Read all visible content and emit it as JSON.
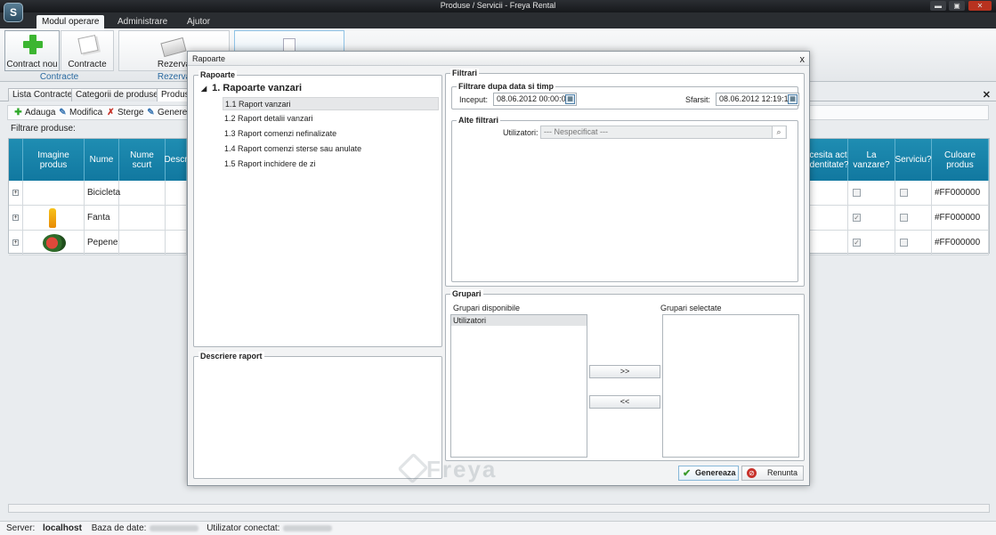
{
  "window": {
    "title": "Produse / Servicii - Freya Rental",
    "logo": "S",
    "minimize": "▬",
    "maximize": "▣",
    "close": "✕"
  },
  "ribbon": {
    "tabs": [
      "Modul operare",
      "Administrare",
      "Ajutor"
    ],
    "buttons": {
      "contract_nou": "Contract nou",
      "contracte": "Contracte",
      "rezerva": "Rezerva"
    },
    "groups": {
      "contracte": "Contracte",
      "rezerva": "Rezerva"
    }
  },
  "main_tabs": [
    "Lista Contracte",
    "Categorii de produse",
    "Produse"
  ],
  "toolbar": {
    "adauga": "Adauga",
    "modifica": "Modifica",
    "sterge": "Sterge",
    "genereaza": "Genereaza"
  },
  "filter_label": "Filtrare produse:",
  "grid": {
    "headers": {
      "imagine": "Imagine produs",
      "nume": "Nume",
      "nume_scurt": "Nume scurt",
      "descriere": "Descr",
      "act": "cesita act identitate?",
      "la_vanzare": "La vanzare?",
      "serviciu": "Serviciu?",
      "culoare": "Culoare produs"
    },
    "rows": [
      {
        "nume": "Bicicleta",
        "culoare": "#FF000000",
        "la_vanzare": false,
        "serviciu": false,
        "image": ""
      },
      {
        "nume": "Fanta",
        "culoare": "#FF000000",
        "la_vanzare": true,
        "serviciu": false,
        "image": "bottle-icon"
      },
      {
        "nume": "Pepene",
        "culoare": "#FF000000",
        "la_vanzare": true,
        "serviciu": false,
        "image": "watermelon-icon"
      }
    ]
  },
  "statusbar": {
    "server_label": "Server:",
    "server_value": "localhost",
    "db_label": "Baza de date:",
    "user_label": "Utilizator conectat:"
  },
  "dialog": {
    "title": "Rapoarte",
    "close": "x",
    "rapoarte_title": "Rapoarte",
    "tree_root": "1. Rapoarte vanzari",
    "items": [
      "1.1 Raport vanzari",
      "1.2 Raport detalii vanzari",
      "1.3 Raport comenzi nefinalizate",
      "1.4 Raport comenzi sterse sau anulate",
      "1.5 Raport inchidere de zi"
    ],
    "descriere_title": "Descriere raport",
    "filtrari_title": "Filtrari",
    "data_title": "Filtrare dupa data si timp",
    "inceput_label": "Inceput:",
    "inceput_value": "08.06.2012 00:00:00",
    "sfarsit_label": "Sfarsit:",
    "sfarsit_value": "08.06.2012 12:19:15",
    "alte_title": "Alte filtrari",
    "utilizatori_label": "Utilizatori:",
    "utilizatori_value": "--- Nespecificat ---",
    "grupari_title": "Grupari",
    "disponibile_label": "Grupari disponibile",
    "selectate_label": "Grupari selectate",
    "disponibile_items": [
      "Utilizatori"
    ],
    "move_right": ">>",
    "move_left": "<<",
    "genereaza": "Genereaza",
    "renunta": "Renunta"
  },
  "watermark": "Freya"
}
